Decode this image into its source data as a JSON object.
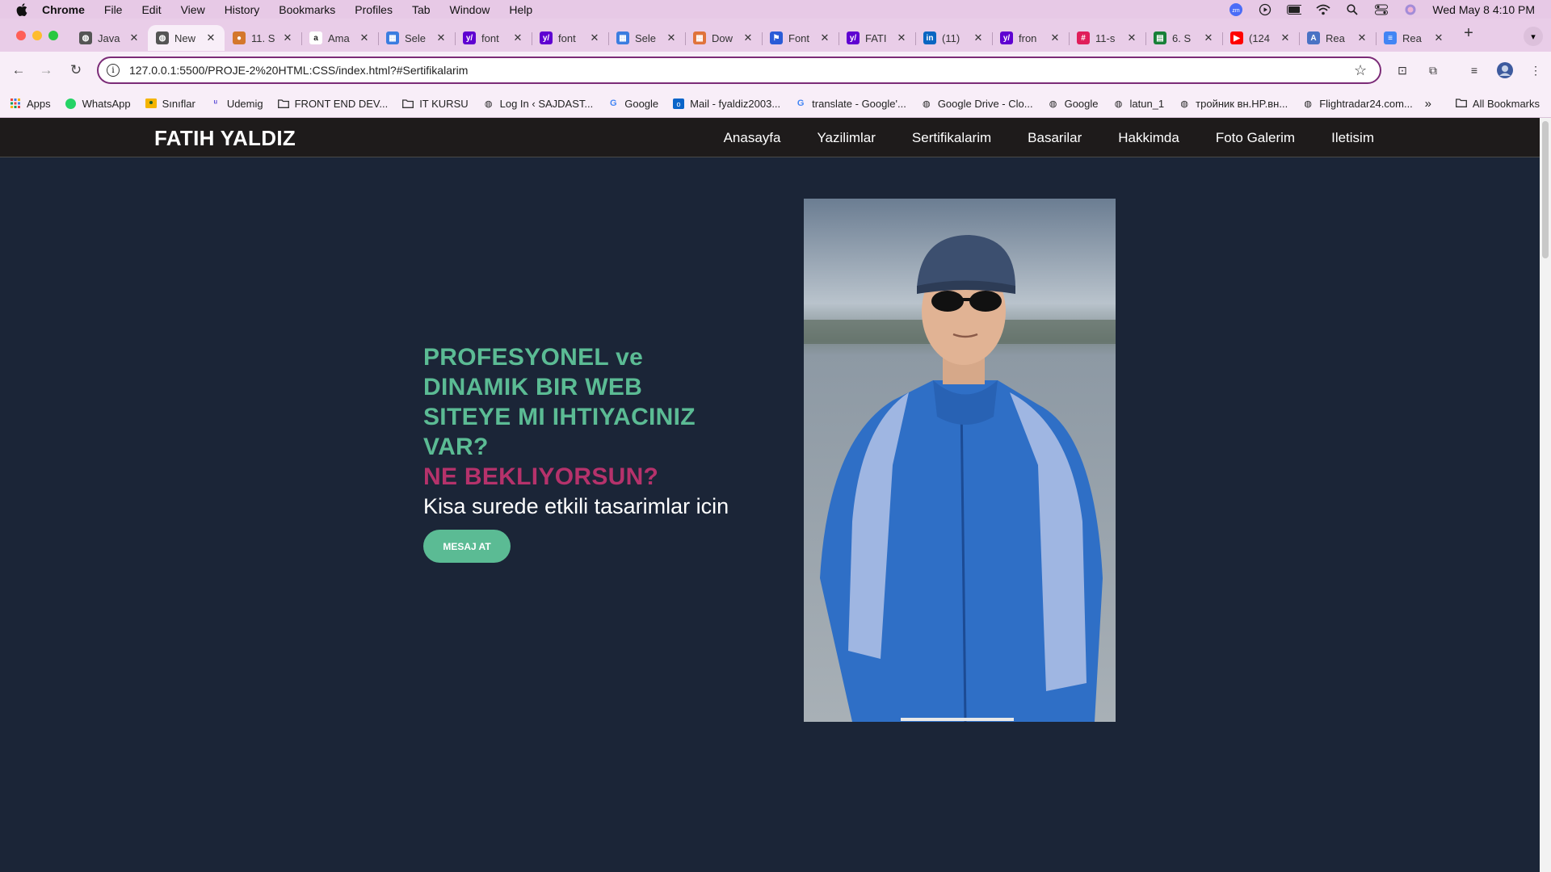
{
  "menubar": {
    "app": "Chrome",
    "items": [
      "File",
      "Edit",
      "View",
      "History",
      "Bookmarks",
      "Profiles",
      "Tab",
      "Window",
      "Help"
    ],
    "clock": "Wed May 8  4:10 PM"
  },
  "tabs": [
    {
      "title": "Java",
      "icon": "globe-icon",
      "color": "#555555"
    },
    {
      "title": "New",
      "icon": "globe-icon",
      "color": "#555555",
      "active": true
    },
    {
      "title": "11. S",
      "icon": "udemy-icon",
      "color": "#d4772c"
    },
    {
      "title": "Ama",
      "icon": "amazon-icon",
      "color": "#222222"
    },
    {
      "title": "Sele",
      "icon": "grid-icon",
      "color": "#3b7de0"
    },
    {
      "title": "font",
      "icon": "yahoo-icon",
      "color": "#5f01d1"
    },
    {
      "title": "font",
      "icon": "yahoo-icon",
      "color": "#5f01d1"
    },
    {
      "title": "Sele",
      "icon": "grid-icon",
      "color": "#3b7de0"
    },
    {
      "title": "Dow",
      "icon": "grid-icon",
      "color": "#e0733b"
    },
    {
      "title": "Font",
      "icon": "flag-icon",
      "color": "#2a5bd7"
    },
    {
      "title": "FATI",
      "icon": "yahoo-icon",
      "color": "#5f01d1"
    },
    {
      "title": "(11)",
      "icon": "linkedin-icon",
      "color": "#0a66c2"
    },
    {
      "title": "fron",
      "icon": "yahoo-icon",
      "color": "#5f01d1"
    },
    {
      "title": "11-s",
      "icon": "slack-icon",
      "color": "#e01e5a"
    },
    {
      "title": "6. S",
      "icon": "sheets-icon",
      "color": "#188038"
    },
    {
      "title": "(124",
      "icon": "youtube-icon",
      "color": "#ff0000"
    },
    {
      "title": "Rea",
      "icon": "docs-icon",
      "color": "#4a72c4"
    },
    {
      "title": "Rea",
      "icon": "docs-icon",
      "color": "#4285f4"
    }
  ],
  "address_bar": {
    "url": "127.0.0.1:5500/PROJE-2%20HTML:CSS/index.html?#Sertifikalarim"
  },
  "bookmarks": [
    {
      "label": "Apps",
      "icon": "apps-grid-icon"
    },
    {
      "label": "WhatsApp",
      "icon": "whatsapp-icon"
    },
    {
      "label": "Sınıflar",
      "icon": "classroom-icon"
    },
    {
      "label": "Udemig",
      "icon": "udemig-icon"
    },
    {
      "label": "FRONT END DEV...",
      "icon": "folder-icon"
    },
    {
      "label": "IT KURSU",
      "icon": "folder-icon"
    },
    {
      "label": "Log In ‹ SAJDAST...",
      "icon": "globe-icon"
    },
    {
      "label": "Google",
      "icon": "google-icon"
    },
    {
      "label": "Mail - fyaldiz2003...",
      "icon": "outlook-icon"
    },
    {
      "label": "translate - Google'...",
      "icon": "google-icon"
    },
    {
      "label": "Google Drive - Clo...",
      "icon": "globe-icon"
    },
    {
      "label": "Google",
      "icon": "globe-icon"
    },
    {
      "label": "latun_1",
      "icon": "globe-icon"
    },
    {
      "label": "тройник вн.HP.вн...",
      "icon": "globe-icon"
    },
    {
      "label": "Flightradar24.com...",
      "icon": "globe-icon"
    }
  ],
  "all_bookmarks": "All Bookmarks",
  "site": {
    "brand": "FATIH YALDIZ",
    "nav": [
      "Anasayfa",
      "Yazilimlar",
      "Sertifikalarim",
      "Basarilar",
      "Hakkimda",
      "Foto Galerim",
      "Iletisim"
    ],
    "headline": "PROFESYONEL ve DINAMIK BIR WEB SITEYE MI IHTIYACINIZ VAR?",
    "subheadline": "NE BEKLIYORSUN?",
    "tagline": "Kisa surede etkili tasarimlar icin",
    "cta": "MESAJ AT",
    "colors": {
      "accent_green": "#5bbb94",
      "accent_pink": "#b5326b",
      "background": "#1b2537",
      "nav_bg": "#1e1b1b"
    }
  }
}
